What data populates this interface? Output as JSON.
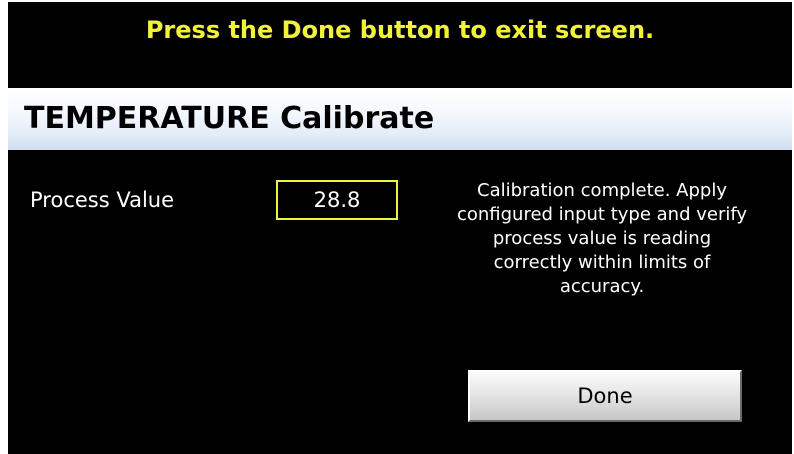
{
  "instruction": "Press the Done button to exit screen.",
  "title": "TEMPERATURE Calibrate",
  "process_value": {
    "label": "Process Value",
    "value": "28.8"
  },
  "message": {
    "lines": [
      "Calibration complete. Apply",
      "configured input type and verify",
      "process value is reading",
      "correctly within limits of",
      "accuracy."
    ]
  },
  "done_button": {
    "label": "Done"
  },
  "colors": {
    "background": "#000000",
    "highlight_yellow": "#f2f23a",
    "text_white": "#ffffff",
    "title_gradient_bottom": "#cfddf1",
    "button_gray": "#d9d9d9"
  }
}
